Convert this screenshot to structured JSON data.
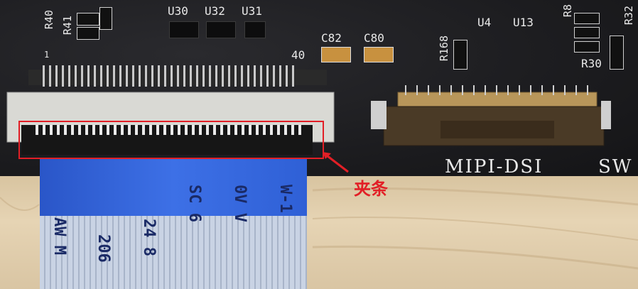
{
  "photo": {
    "silkscreen": {
      "u30": "U30",
      "u32": "U32",
      "u31": "U31",
      "u4": "U4",
      "u13": "U13",
      "c82": "C82",
      "c80": "C80",
      "r40": "R40",
      "r41": "R41",
      "r168": "R168",
      "r30": "R30",
      "r32": "R32",
      "r8": "R8",
      "pin1": "1",
      "pin40": "40",
      "mipi_dsi": "MIPI-DSI",
      "sw": "SW"
    },
    "cable_print": {
      "col1": "AW M",
      "col2": "206",
      "col3": "24 8",
      "col4": "SC 6",
      "col5": "0V V",
      "col6": "W-1"
    },
    "annotation": {
      "label": "夹条",
      "color": "#e21f26"
    }
  }
}
